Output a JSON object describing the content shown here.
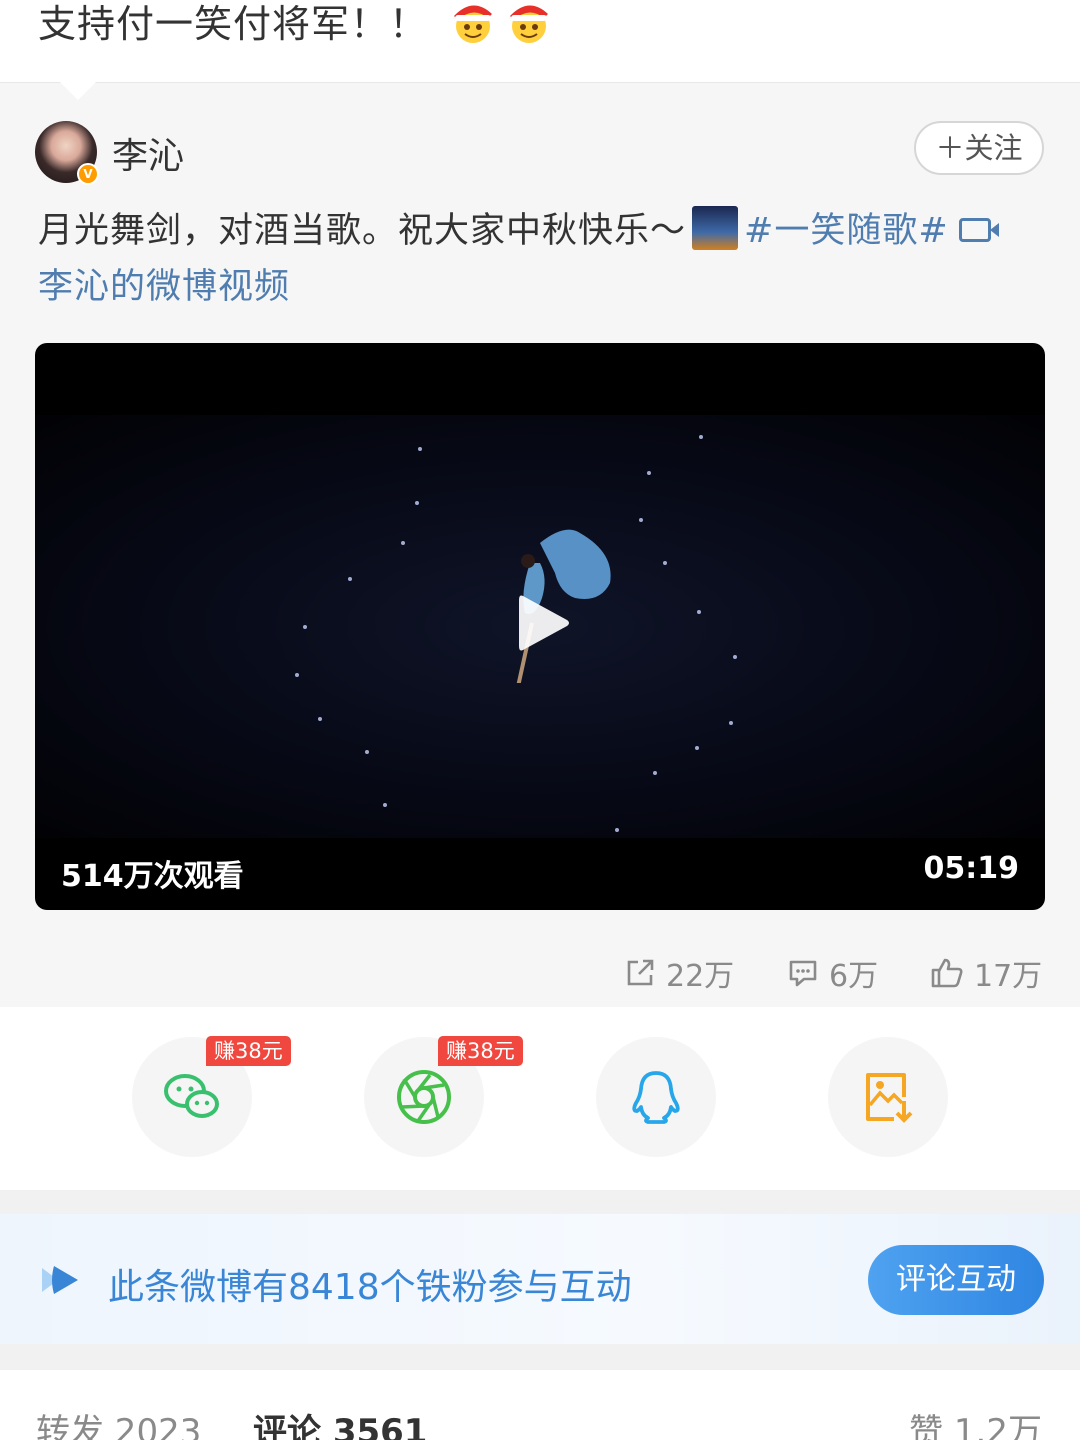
{
  "top_comment": {
    "text": "支持付一笑付将军！！"
  },
  "post": {
    "author": "李沁",
    "follow_label": "＋关注",
    "text_main": "月光舞剑，对酒当歌。祝大家中秋快乐～",
    "hashtag": "#一笑随歌#",
    "video_link": "李沁的微博视频"
  },
  "video": {
    "views": "514万次观看",
    "duration": "05:19"
  },
  "stats": {
    "reposts": "22万",
    "comments": "6万",
    "likes": "17万"
  },
  "share": {
    "earn_badge_1": "赚38元",
    "earn_badge_2": "赚38元"
  },
  "fans_banner": {
    "text": "此条微博有8418个铁粉参与互动",
    "button": "评论互动"
  },
  "tabs": {
    "repost": "转发 2023",
    "comment": "评论 3561",
    "like": "赞 1.2万"
  }
}
